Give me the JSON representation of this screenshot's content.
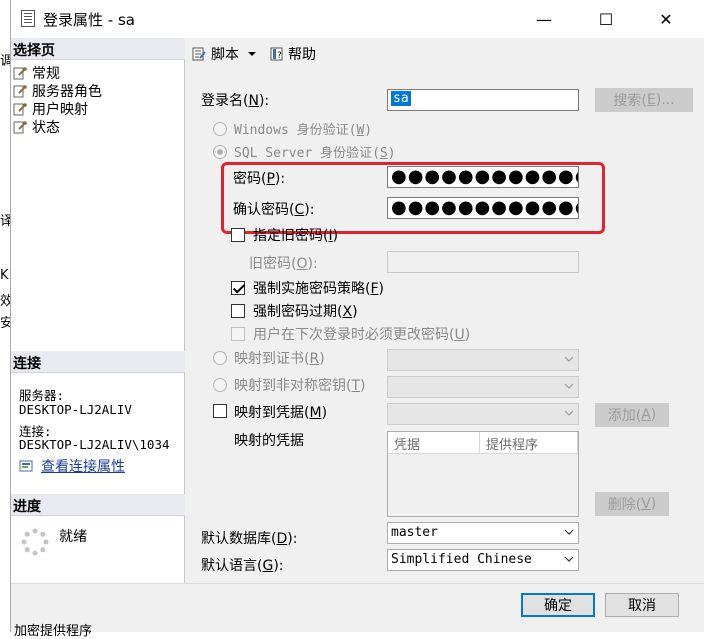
{
  "window": {
    "title": "登录属性 - sa",
    "minimize": "—",
    "maximize": "☐",
    "close": "✕"
  },
  "left": {
    "select_page_header": "选择页",
    "pages": [
      {
        "label": "常规",
        "icon": "wrench-page-icon"
      },
      {
        "label": "服务器角色",
        "icon": "wrench-page-icon"
      },
      {
        "label": "用户映射",
        "icon": "wrench-page-icon"
      },
      {
        "label": "状态",
        "icon": "wrench-page-icon"
      }
    ],
    "connection_header": "连接",
    "server_label": "服务器:",
    "server_value": "DESKTOP-LJ2ALIV",
    "connection_label": "连接:",
    "connection_value": "DESKTOP-LJ2ALIV\\1034",
    "view_conn_props": "查看连接属性",
    "progress_header": "进度",
    "progress_status": "就绪"
  },
  "toolbar": {
    "script_label": "脚本",
    "help_label": "帮助"
  },
  "form": {
    "login_name_label": "登录名(",
    "login_name_key": "N",
    "login_name_suffix": "):",
    "login_name_value": "sa",
    "search_button": "搜索(",
    "search_key": "E",
    "search_suffix": ")...",
    "windows_auth": "Windows 身份验证(",
    "windows_key": "W",
    "sql_auth": "SQL Server 身份验证(",
    "sql_key": "S",
    "password_label": "密码(",
    "password_key": "P",
    "password_value": "●●●●●●●●●●●●●◖",
    "confirm_label": "确认密码(",
    "confirm_key": "C",
    "confirm_value": "●●●●●●●●●●●●●◖",
    "specify_old": "指定旧密码(",
    "specify_old_key": "I",
    "old_password_label": "旧密码(",
    "old_password_key": "O",
    "enforce_policy": "强制实施密码策略(",
    "enforce_policy_key": "F",
    "enforce_expiration": "强制密码过期(",
    "enforce_expiration_key": "X",
    "must_change": "用户在下次登录时必须更改密码(",
    "must_change_key": "U",
    "map_cert": "映射到证书(",
    "map_cert_key": "R",
    "map_asym": "映射到非对称密钥(",
    "map_asym_key": "T",
    "map_cred": "映射到凭据(",
    "map_cred_key": "M",
    "add_button": "添加(",
    "add_key": "A",
    "mapped_creds_label": "映射的凭据",
    "grid_col_cred": "凭据",
    "grid_col_provider": "提供程序",
    "remove_button": "删除(",
    "remove_key": "V",
    "default_db_label": "默认数据库(",
    "default_db_key": "D",
    "default_db_value": "master",
    "default_lang_label": "默认语言(",
    "default_lang_key": "G",
    "default_lang_value": "Simplified Chinese",
    "close_paren": ")",
    "close_paren_colon": "):"
  },
  "footer": {
    "ok_button": "确定",
    "cancel_button": "取消"
  },
  "background_fragments": {
    "f1": "调",
    "f2": "译",
    "f3": "K",
    "f4": "效",
    "f5": "安",
    "f6": "加密提供程序"
  },
  "colors": {
    "highlight": "#e0242c",
    "selection": "#0078d7",
    "link": "#1a3d9e"
  }
}
